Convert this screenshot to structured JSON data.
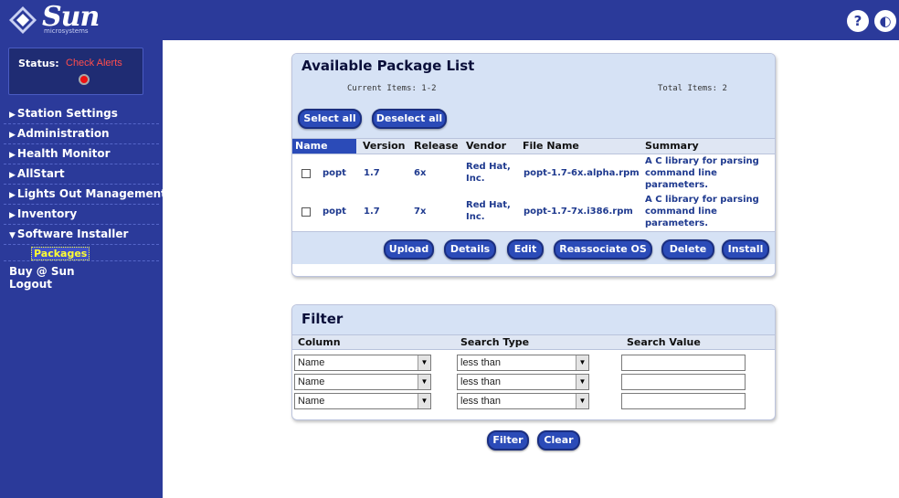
{
  "brand": {
    "name": "Sun",
    "sub": "microsystems"
  },
  "header": {
    "help_icon": "?",
    "logout_icon": "◐"
  },
  "status": {
    "label": "Status:",
    "alert": "Check Alerts"
  },
  "sidebar": {
    "items": [
      {
        "label": "Station Settings",
        "arrow": "▶"
      },
      {
        "label": "Administration",
        "arrow": "▶"
      },
      {
        "label": "Health Monitor",
        "arrow": "▶"
      },
      {
        "label": "AllStart",
        "arrow": "▶"
      },
      {
        "label": "Lights Out Management",
        "arrow": "▶"
      },
      {
        "label": "Inventory",
        "arrow": "▶"
      },
      {
        "label": "Software Installer",
        "arrow": "▼"
      }
    ],
    "sub_item": "Packages",
    "buy": "Buy @ Sun",
    "logout": "Logout"
  },
  "packages": {
    "title": "Available Package List",
    "current_items": "Current Items: 1-2",
    "total_items": "Total Items: 2",
    "select_all": "Select all",
    "deselect_all": "Deselect all",
    "columns": [
      "Name",
      "Version",
      "Release",
      "Vendor",
      "File Name",
      "Summary"
    ],
    "rows": [
      {
        "name": "popt",
        "version": "1.7",
        "release": "6x",
        "vendor_1": "Red Hat,",
        "vendor_2": "Inc.",
        "file": "popt-1.7-6x.alpha.rpm",
        "summary_1": "A C library for parsing",
        "summary_2": "command line",
        "summary_3": "parameters."
      },
      {
        "name": "popt",
        "version": "1.7",
        "release": "7x",
        "vendor_1": "Red Hat,",
        "vendor_2": "Inc.",
        "file": "popt-1.7-7x.i386.rpm",
        "summary_1": "A C library for parsing",
        "summary_2": "command line",
        "summary_3": "parameters."
      }
    ],
    "actions": {
      "upload": "Upload",
      "details": "Details",
      "edit": "Edit",
      "reassociate": "Reassociate OS",
      "delete": "Delete",
      "install": "Install"
    }
  },
  "filter": {
    "title": "Filter",
    "col_column": "Column",
    "col_search_type": "Search Type",
    "col_search_value": "Search Value",
    "rows": [
      {
        "column": "Name",
        "type": "less than",
        "value": ""
      },
      {
        "column": "Name",
        "type": "less than",
        "value": ""
      },
      {
        "column": "Name",
        "type": "less than",
        "value": ""
      }
    ],
    "filter_btn": "Filter",
    "clear_btn": "Clear"
  }
}
